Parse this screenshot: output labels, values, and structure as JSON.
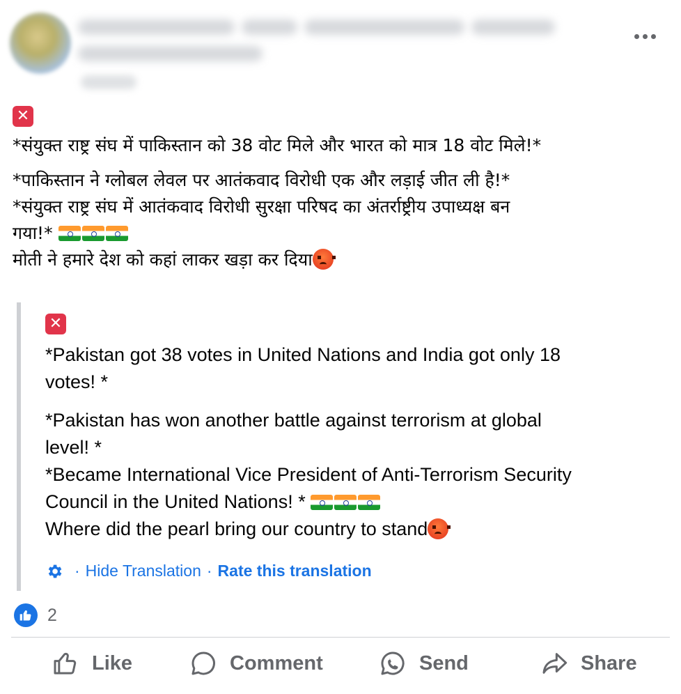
{
  "post": {
    "hindi_lines": [
      "*संयुक्त राष्ट्र संघ में पाकिस्तान को 38 वोट मिले और भारत को मात्र 18 वोट मिले!*",
      " *पाकिस्तान ने ग्लोबल लेवल पर आतंकवाद विरोधी एक और लड़ाई जीत ली है!*",
      "*संयुक्त राष्ट्र संघ में आतंकवाद विरोधी सुरक्षा परिषद का अंतर्राष्ट्रीय उपाध्यक्ष बन",
      "गया!* ",
      "मोती ने हमारे देश को कहां लाकर खड़ा कर दिया"
    ],
    "badge_symbol": "✕"
  },
  "translation": {
    "lines": [
      "*Pakistan got 38 votes in United Nations and India got only 18",
      "votes! *",
      "*Pakistan has won another battle against terrorism at global",
      "level! *",
      "*Became International Vice President of Anti-Terrorism Security",
      "Council in the United Nations! * ",
      "Where did the pearl bring our country to stand"
    ],
    "hide_label": "Hide Translation",
    "rate_label": "Rate this translation",
    "separator": "·"
  },
  "reactions": {
    "count": "2"
  },
  "actions": {
    "like": "Like",
    "comment": "Comment",
    "send": "Send",
    "share": "Share"
  },
  "colors": {
    "link_blue": "#1b74e4",
    "muted_gray": "#65676b",
    "badge_red": "#e1344a"
  }
}
